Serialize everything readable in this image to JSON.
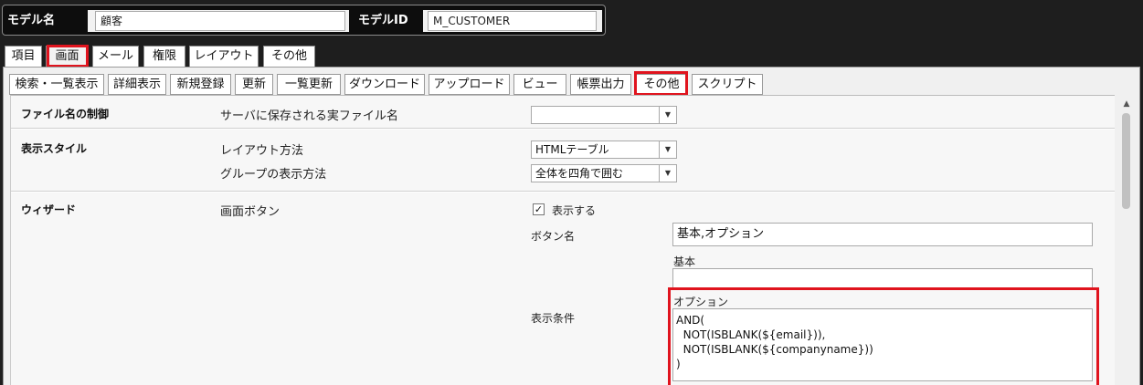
{
  "header": {
    "model_name_label": "モデル名",
    "model_name_value": "顧客",
    "model_id_label": "モデルID",
    "model_id_value": "M_CUSTOMER"
  },
  "top_tabs": [
    "項目",
    "画面",
    "メール",
    "権限",
    "レイアウト",
    "その他"
  ],
  "sub_tabs": [
    "検索・一覧表示",
    "詳細表示",
    "新規登録",
    "更新",
    "一覧更新",
    "ダウンロード",
    "アップロード",
    "ビュー",
    "帳票出力",
    "その他",
    "スクリプト"
  ],
  "file_section": {
    "title": "ファイル名の制御",
    "label": "サーバに保存される実ファイル名",
    "value": ""
  },
  "style_section": {
    "title": "表示スタイル",
    "layout_label": "レイアウト方法",
    "layout_value": "HTMLテーブル",
    "group_label": "グループの表示方法",
    "group_value": "全体を四角で囲む"
  },
  "wizard_section": {
    "title": "ウィザード",
    "screen_button_label": "画面ボタン",
    "show_checkbox_label": "表示する",
    "show_checked": true,
    "check_mark": "✓",
    "button_name_label": "ボタン名",
    "button_name_value": "基本,オプション",
    "condition_label": "表示条件",
    "basic_label": "基本",
    "basic_value": "",
    "option_label": "オプション",
    "option_value": "AND(\n  NOT(ISBLANK(${email})),\n  NOT(ISBLANK(${companyname}))\n)"
  },
  "icons": {
    "dropdown": "▼",
    "scroll_up": "▲"
  },
  "colors": {
    "highlight": "#e0141e",
    "background": "#1e1e1e"
  }
}
